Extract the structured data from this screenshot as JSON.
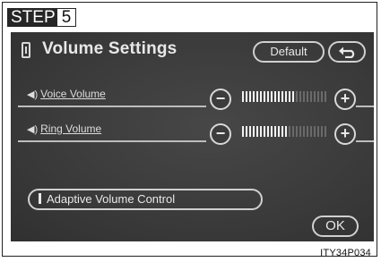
{
  "step": {
    "label": "STEP",
    "number": "5"
  },
  "screen": {
    "title": "Volume Settings",
    "default_label": "Default",
    "rows": [
      {
        "label": "Voice Volume",
        "level": 0.62
      },
      {
        "label": "Ring Volume",
        "level": 0.55
      }
    ],
    "adaptive_label": "Adaptive Volume Control",
    "ok_label": "OK"
  },
  "caption": "ITY34P034",
  "colors": {
    "screen_bg": "#3c3c3c",
    "foreground": "#e8e8e8",
    "bar_on": "#f2f2f2",
    "bar_off": "#6a6a6a"
  }
}
